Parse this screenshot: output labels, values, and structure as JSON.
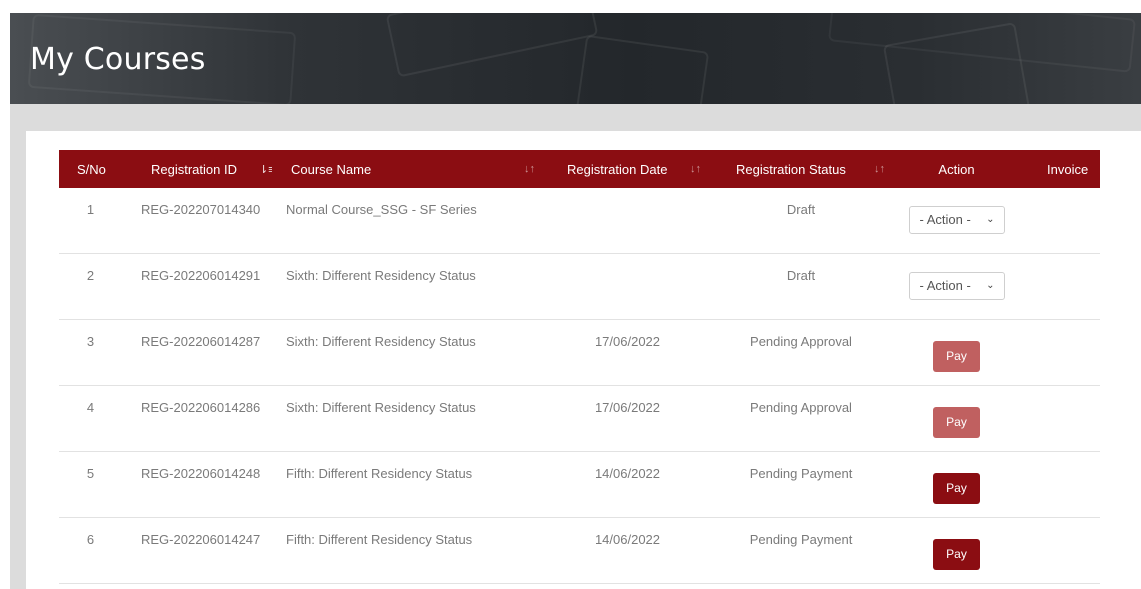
{
  "page": {
    "title": "My Courses"
  },
  "colors": {
    "header_bg": "#8b0d12",
    "pay_active": "#8b0d12",
    "pay_disabled": "#c06060"
  },
  "table": {
    "headers": {
      "sn": "S/No",
      "reg_id": "Registration ID",
      "course": "Course Name",
      "reg_date": "Registration Date",
      "status": "Registration Status",
      "action": "Action",
      "invoice": "Invoice"
    },
    "rows": [
      {
        "sn": "1",
        "reg_id": "REG-202207014340",
        "course": "Normal Course_SSG - SF Series",
        "date": "",
        "status": "Draft",
        "action": "- Action -"
      },
      {
        "sn": "2",
        "reg_id": "REG-202206014291",
        "course": "Sixth: Different Residency Status",
        "date": "",
        "status": "Draft",
        "action": "- Action -"
      },
      {
        "sn": "3",
        "reg_id": "REG-202206014287",
        "course": "Sixth: Different Residency Status",
        "date": "17/06/2022",
        "status": "Pending Approval",
        "action": "Pay"
      },
      {
        "sn": "4",
        "reg_id": "REG-202206014286",
        "course": "Sixth: Different Residency Status",
        "date": "17/06/2022",
        "status": "Pending Approval",
        "action": "Pay"
      },
      {
        "sn": "5",
        "reg_id": "REG-202206014248",
        "course": "Fifth: Different Residency Status",
        "date": "14/06/2022",
        "status": "Pending Payment",
        "action": "Pay"
      },
      {
        "sn": "6",
        "reg_id": "REG-202206014247",
        "course": "Fifth: Different Residency Status",
        "date": "14/06/2022",
        "status": "Pending Payment",
        "action": "Pay"
      }
    ]
  }
}
